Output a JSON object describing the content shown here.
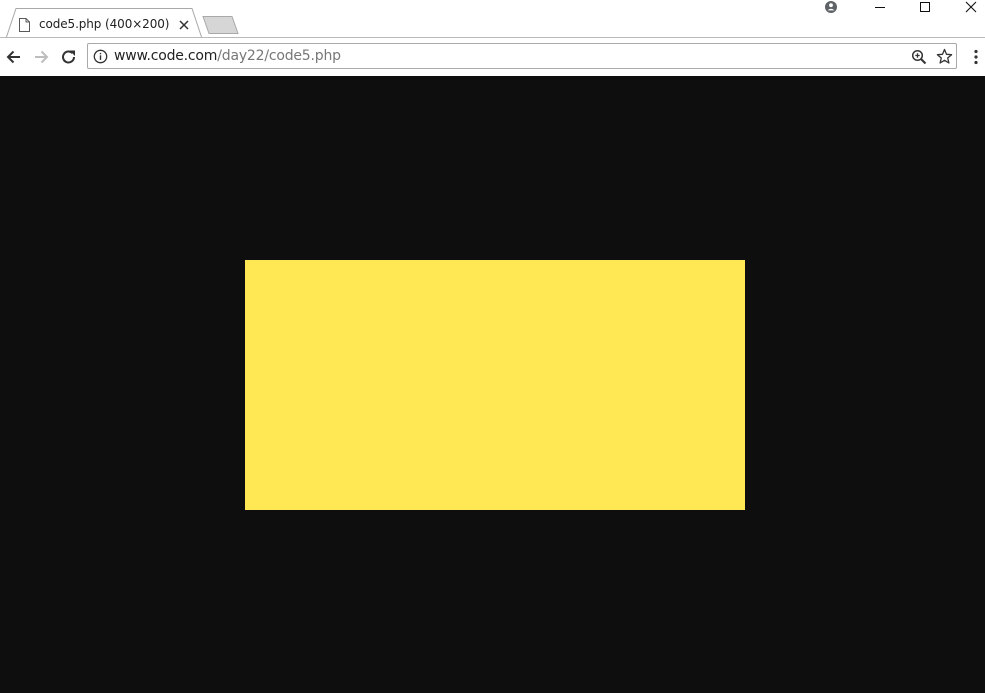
{
  "tab": {
    "title": "code5.php (400×200)",
    "icon": "page-icon",
    "close_icon": "close-icon"
  },
  "window_controls": {
    "profile_icon": "profile-icon",
    "minimize_icon": "minimize-icon",
    "maximize_icon": "maximize-icon",
    "close_icon": "close-icon"
  },
  "toolbar": {
    "back_icon": "arrow-left-icon",
    "forward_icon": "arrow-right-icon",
    "reload_icon": "reload-icon",
    "menu_icon": "more-vertical-icon"
  },
  "omnibox": {
    "url_host": "www.code.com",
    "url_path": "/day22/code5.php",
    "info_icon": "info-icon",
    "zoom_icon": "zoom-icon",
    "bookmark_icon": "star-icon"
  },
  "content": {
    "background_color": "#0e0e0e",
    "rect_color": "#ffe853"
  }
}
